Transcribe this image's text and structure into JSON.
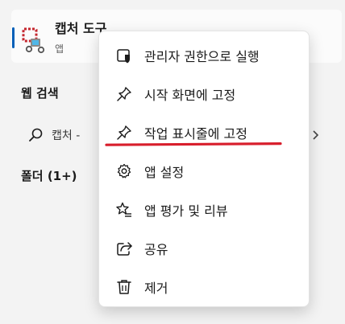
{
  "best_match": {
    "title": "캡처 도구",
    "subtitle": "앱"
  },
  "sections": {
    "web_search": "웹 검색",
    "folders": "폴더 (1+)"
  },
  "web_result": {
    "text": "캡처 - "
  },
  "context_menu": {
    "items": [
      {
        "label": "관리자 권한으로 실행",
        "icon": "shield-icon"
      },
      {
        "label": "시작 화면에 고정",
        "icon": "pin-icon"
      },
      {
        "label": "작업 표시줄에 고정",
        "icon": "pin-icon"
      },
      {
        "label": "앱 설정",
        "icon": "gear-icon"
      },
      {
        "label": "앱 평가 및 리뷰",
        "icon": "star-list-icon"
      },
      {
        "label": "공유",
        "icon": "share-icon"
      },
      {
        "label": "제거",
        "icon": "trash-icon"
      }
    ]
  },
  "colors": {
    "accent": "#005fb8",
    "annotation_red": "#d81e2c"
  }
}
